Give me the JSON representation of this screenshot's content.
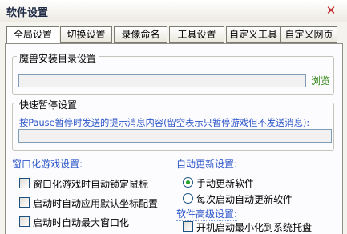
{
  "window": {
    "title": "软件设置"
  },
  "tabs": [
    "全局设置",
    "切换设置",
    "录像命名",
    "工具设置",
    "自定义工具",
    "自定义网页"
  ],
  "install_group": {
    "label": "魔兽安装目录设置",
    "path_value": "",
    "browse_label": "浏览"
  },
  "pause_group": {
    "label": "快速暂停设置",
    "hint": "按Pause暂停时发送的提示消息内容(留空表示只暂停游戏但不发送消息):",
    "message_value": ""
  },
  "window_section": {
    "title": "窗口化游戏设置:",
    "options": [
      {
        "label": "窗口化游戏时自动锁定鼠标",
        "checked": false
      },
      {
        "label": "启动时自动应用默认坐标配置",
        "checked": false
      },
      {
        "label": "启动时自动最大窗口化",
        "checked": false
      }
    ]
  },
  "update_section": {
    "title": "自动更新设置:",
    "options": [
      {
        "label": "手动更新软件",
        "selected": true
      },
      {
        "label": "每次启动自动更新软件",
        "selected": false
      }
    ]
  },
  "advanced_section": {
    "title": "软件高级设置:",
    "options": [
      {
        "label": "开机启动最小化到系统托盘",
        "checked": false
      }
    ]
  }
}
